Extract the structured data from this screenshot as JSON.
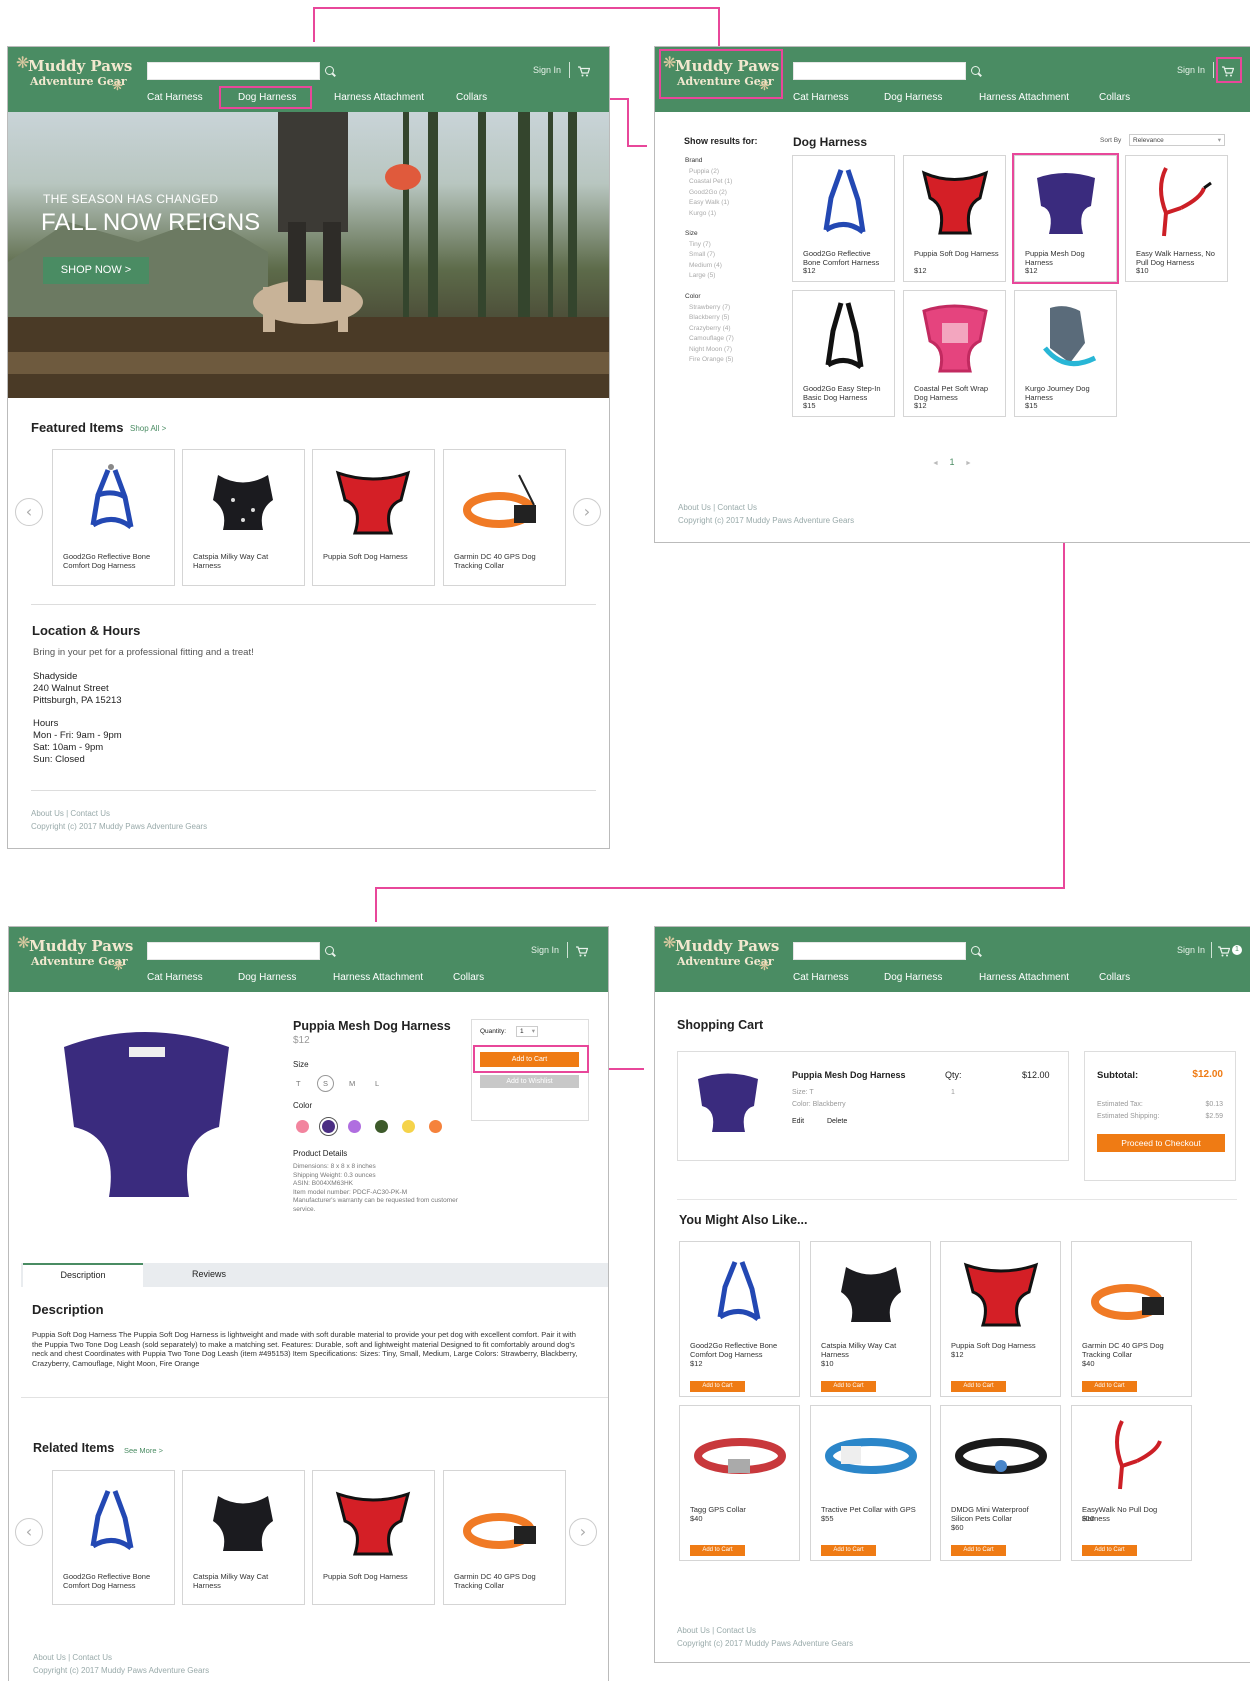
{
  "brand": {
    "line1": "Muddy Paws",
    "line2": "Adventure Gear"
  },
  "header": {
    "sign_in": "Sign In",
    "cart_count": "1"
  },
  "nav": [
    "Cat Harness",
    "Dog Harness",
    "Harness Attachment",
    "Collars"
  ],
  "footer": {
    "links": "About Us | Contact Us",
    "copyright": "Copyright (c) 2017 Muddy Paws Adventure Gears"
  },
  "home": {
    "hero": {
      "small": "THE SEASON HAS CHANGED",
      "big": "FALL NOW REIGNS",
      "button": "SHOP NOW >"
    },
    "featured_title": "Featured Items",
    "shop_all": "Shop All >",
    "featured": [
      "Good2Go Reflective Bone Comfort Dog Harness",
      "Catspia Milky Way Cat Harness",
      "Puppia Soft Dog Harness",
      "Garmin DC 40 GPS Dog Tracking Collar"
    ],
    "location_title": "Location & Hours",
    "location_sub": "Bring in your pet for a professional fitting and a treat!",
    "address": [
      "Shadyside",
      "240 Walnut Street",
      "Pittsburgh, PA 15213"
    ],
    "hours": [
      "Hours",
      "Mon - Fri: 9am - 9pm",
      "Sat: 10am - 9pm",
      "Sun: Closed"
    ]
  },
  "listing": {
    "filters_title": "Show results for:",
    "brand_title": "Brand",
    "brands": [
      "Puppia (2)",
      "Coastal Pet (1)",
      "Good2Go (2)",
      "Easy Walk (1)",
      "Kurgo (1)"
    ],
    "size_title": "Size",
    "sizes": [
      "Tiny (7)",
      "Small (7)",
      "Medium (4)",
      "Large (5)"
    ],
    "color_title": "Color",
    "colors": [
      "Strawberry (7)",
      "Blackberry (5)",
      "Crazyberry (4)",
      "Camouflage (7)",
      "Night Moon (7)",
      "Fire Orange (5)"
    ],
    "title": "Dog Harness",
    "sort_label": "Sort By",
    "sort_value": "Relevance",
    "products": [
      {
        "name": "Good2Go Reflective Bone Comfort Harness",
        "price": "$12"
      },
      {
        "name": "Puppia Soft Dog Harness",
        "price": "$12"
      },
      {
        "name": "Puppia Mesh Dog Harness",
        "price": "$12"
      },
      {
        "name": "Easy Walk Harness, No Pull Dog Harness",
        "price": "$10"
      },
      {
        "name": "Good2Go Easy Step-In Basic Dog Harness",
        "price": "$15"
      },
      {
        "name": "Coastal Pet Soft Wrap Dog Harness",
        "price": "$12"
      },
      {
        "name": "Kurgo Journey Dog Harness",
        "price": "$15"
      }
    ],
    "pagination": {
      "prev": "◄",
      "page": "1",
      "next": "►"
    }
  },
  "product": {
    "name": "Puppia Mesh Dog Harness",
    "price": "$12",
    "size_label": "Size",
    "sizes": [
      "T",
      "S",
      "M",
      "L"
    ],
    "color_label": "Color",
    "swatches": [
      "#f2849e",
      "#4b2e83",
      "#b06ee0",
      "#3d5a2a",
      "#f5d34a",
      "#f5823c"
    ],
    "details_label": "Product Details",
    "details": [
      "Dimensions: 8 x 8 x 8 inches",
      "Shipping Weight: 0.3 ounces",
      "ASIN: B004XM63HK",
      "Item model number: PDCF-AC30-PK-M",
      "Manufacturer's warranty can be requested from customer service."
    ],
    "quantity_label": "Quantity:",
    "quantity": "1",
    "add_to_cart": "Add to Cart",
    "add_to_wishlist": "Add to Wishlist",
    "tabs": [
      "Description",
      "Reviews"
    ],
    "desc_title": "Description",
    "desc": "Puppia Soft Dog Harness The Puppia Soft Dog Harness is lightweight and made with soft durable material to provide your pet dog with excellent comfort. Pair it with the Puppia Two Tone Dog Leash (sold separately) to make a matching set. Features: Durable, soft and lightweight material Designed to fit comfortably around dog's neck and chest Coordinates with Puppia Two Tone Dog Leash (item #495153) Item Specifications: Sizes: Tiny, Small, Medium, Large Colors: Strawberry, Blackberry, Crazyberry, Camouflage, Night Moon, Fire Orange",
    "related_title": "Related Items",
    "see_more": "See More >",
    "related": [
      "Good2Go Reflective Bone Comfort Dog Harness",
      "Catspia Milky Way Cat Harness",
      "Puppia Soft Dog Harness",
      "Garmin DC 40 GPS Dog Tracking Collar"
    ]
  },
  "cart": {
    "title": "Shopping Cart",
    "item": {
      "name": "Puppia Mesh Dog Harness",
      "size": "Size: T",
      "color": "Color: Blackberry",
      "edit": "Edit",
      "delete": "Delete",
      "qty_label": "Qty:",
      "qty": "1",
      "price": "$12.00"
    },
    "summary": {
      "subtotal_label": "Subtotal:",
      "subtotal": "$12.00",
      "tax_label": "Estimated Tax:",
      "tax": "$0.13",
      "ship_label": "Estimated Shipping:",
      "ship": "$2.59",
      "checkout": "Proceed to Checkout"
    },
    "also_title": "You Might Also Like...",
    "also": [
      {
        "name": "Good2Go Reflective Bone Comfort Dog Harness",
        "price": "$12"
      },
      {
        "name": "Catspia Milky Way Cat Harness",
        "price": "$10"
      },
      {
        "name": "Puppia Soft Dog Harness",
        "price": "$12"
      },
      {
        "name": "Garmin DC 40 GPS Dog Tracking Collar",
        "price": "$40"
      },
      {
        "name": "Tagg GPS Collar",
        "price": "$40"
      },
      {
        "name": "Tractive Pet Collar with GPS",
        "price": "$55"
      },
      {
        "name": "DMDG Mini Waterproof Silicon Pets Collar",
        "price": "$60"
      },
      {
        "name": "EasyWalk No Pull Dog Harness",
        "price": "$10"
      }
    ],
    "add_label": "Add to Cart"
  },
  "colors": {
    "header_green": "#4a8c63",
    "accent_orange": "#ef7b14",
    "highlight_pink": "#e8479a"
  }
}
